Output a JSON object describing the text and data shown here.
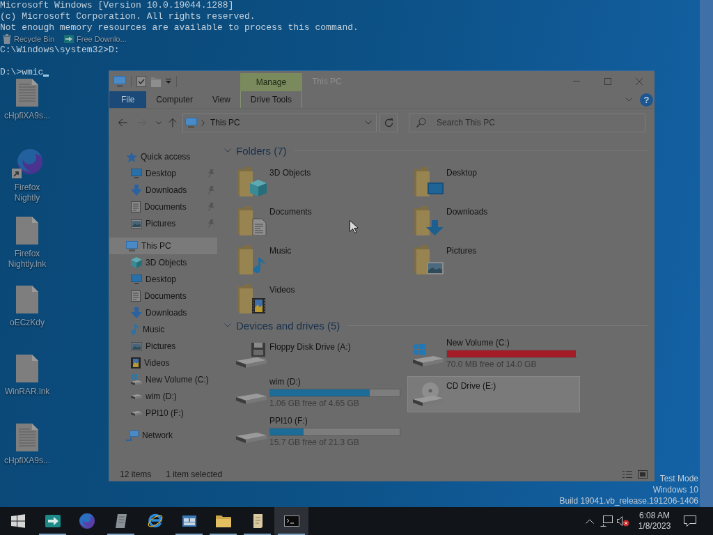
{
  "console": {
    "blocks": [
      [
        "Microsoft Windows [Version 10.0.19044.1288]",
        "(c) Microsoft Corporation. All rights reserved.",
        "Not enough memory resources are available to process this command."
      ],
      [
        "C:\\Windows\\system32>D:"
      ],
      [
        "D:\\>wmic"
      ]
    ]
  },
  "desktop_icons": [
    {
      "label": "Recycle Bin"
    },
    {
      "label": "Free Downlo..."
    },
    {
      "label": "cHpfiXA9s..."
    },
    {
      "label": "Firefox Nightly"
    },
    {
      "label": "Firefox Nightly.lnk"
    },
    {
      "label": "oECzKdy"
    },
    {
      "label": "WinRAR.lnk"
    },
    {
      "label": "cHpfiXA9s..."
    }
  ],
  "explorer": {
    "window": {
      "title": "This PC",
      "context_header": "Manage"
    },
    "ribbon": {
      "tabs": [
        {
          "label": "File",
          "kind": "file"
        },
        {
          "label": "Computer",
          "kind": "tab"
        },
        {
          "label": "View",
          "kind": "tab"
        },
        {
          "label": "Drive Tools",
          "kind": "context"
        }
      ],
      "help": "?"
    },
    "address": {
      "path": "This PC"
    },
    "search": {
      "placeholder": "Search This PC"
    },
    "nav_pane": {
      "items": [
        {
          "label": "Quick access",
          "selected": false,
          "children": [
            {
              "label": "Desktop",
              "pinned": true,
              "selected": false
            },
            {
              "label": "Downloads",
              "pinned": true,
              "selected": false
            },
            {
              "label": "Documents",
              "pinned": true,
              "selected": false
            },
            {
              "label": "Pictures",
              "pinned": true,
              "selected": false
            }
          ]
        },
        {
          "label": "This PC",
          "selected": true,
          "children": [
            {
              "label": "3D Objects",
              "pinned": false,
              "selected": false
            },
            {
              "label": "Desktop",
              "pinned": false,
              "selected": false
            },
            {
              "label": "Documents",
              "pinned": false,
              "selected": false
            },
            {
              "label": "Downloads",
              "pinned": false,
              "selected": false
            },
            {
              "label": "Music",
              "pinned": false,
              "selected": false
            },
            {
              "label": "Pictures",
              "pinned": false,
              "selected": false
            },
            {
              "label": "Videos",
              "pinned": false,
              "selected": false
            },
            {
              "label": "New Volume (C:)",
              "pinned": false,
              "selected": false
            },
            {
              "label": "wim (D:)",
              "pinned": false,
              "selected": false
            },
            {
              "label": "PPI10 (F:)",
              "pinned": false,
              "selected": false
            }
          ]
        },
        {
          "label": "Network",
          "selected": false
        }
      ]
    },
    "groups": [
      {
        "title": "Folders (7)",
        "kind": "folders",
        "expanded": true,
        "items": [
          {
            "label": "3D Objects"
          },
          {
            "label": "Desktop"
          },
          {
            "label": "Documents"
          },
          {
            "label": "Downloads"
          },
          {
            "label": "Music"
          },
          {
            "label": "Pictures"
          },
          {
            "label": "Videos"
          }
        ]
      },
      {
        "title": "Devices and drives (5)",
        "kind": "drives",
        "expanded": true,
        "items": [
          {
            "label": "Floppy Disk Drive (A:)",
            "selected": false
          },
          {
            "label": "New Volume (C:)",
            "level": 0.995,
            "critical": true,
            "free": "70.0 MB free of 14.0 GB",
            "selected": false
          },
          {
            "label": "wim (D:)",
            "level": 0.77,
            "critical": false,
            "free": "1.06 GB free of 4.65 GB",
            "selected": false
          },
          {
            "label": "CD Drive (E:)",
            "selected": true
          },
          {
            "label": "PPI10 (F:)",
            "level": 0.26,
            "critical": false,
            "free": "15.7 GB free of 21.3 GB",
            "selected": false
          }
        ]
      }
    ],
    "status_bar": [
      "12 items",
      "1 item selected"
    ]
  },
  "taskbar": {
    "items": [
      {
        "running": true,
        "active": false
      },
      {
        "running": false,
        "active": false
      },
      {
        "running": true,
        "active": false
      },
      {
        "running": false,
        "active": false
      },
      {
        "running": true,
        "active": false
      },
      {
        "running": true,
        "active": false
      },
      {
        "running": true,
        "active": false
      },
      {
        "running": true,
        "active": true
      }
    ],
    "volume": {
      "muted": true
    },
    "clock": {
      "time": "6:08 AM",
      "date": "1/8/2023"
    }
  },
  "build_info": [
    "Test Mode",
    "Windows 10",
    "Build 19041.vb_release.191206-1406"
  ]
}
